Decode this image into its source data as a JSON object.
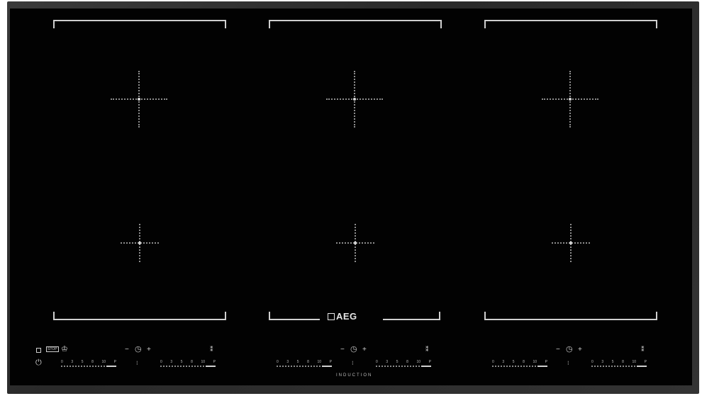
{
  "brand": {
    "logo_text": "AEG",
    "tagline": "INDUCTION"
  },
  "controls": {
    "minus_label": "−",
    "plus_label": "+",
    "timer_icon": "timer-icon",
    "bridge_icon": "bridge-icon",
    "stop_label": "STOP",
    "power_levels": [
      "0",
      "3",
      "5",
      "8",
      "10",
      "P"
    ]
  },
  "icons": {
    "lock": "lock-icon",
    "stopgo": "stop-go-icon",
    "hob2hood": "chef-hat-icon",
    "power": "power-icon"
  },
  "colors": {
    "glass": "#020202",
    "frame": "#333333",
    "markings": "#cfcfcf"
  }
}
